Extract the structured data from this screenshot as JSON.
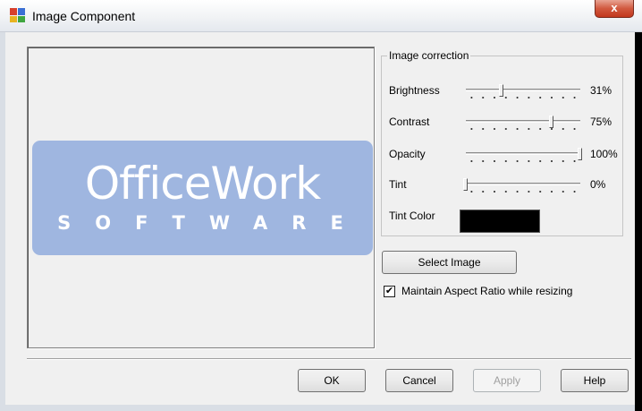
{
  "window": {
    "title": "Image Component",
    "close_glyph": "x"
  },
  "preview": {
    "logo_main": "OfficeWork",
    "logo_sub": "SOFTWARE",
    "logo_color": "#9fb6e0"
  },
  "image_correction": {
    "legend": "Image correction",
    "sliders": [
      {
        "label": "Brightness",
        "value_text": "31%",
        "value": 0.31
      },
      {
        "label": "Contrast",
        "value_text": "75%",
        "value": 0.75
      },
      {
        "label": "Opacity",
        "value_text": "100%",
        "value": 1.0
      },
      {
        "label": "Tint",
        "value_text": "0%",
        "value": 0.0
      }
    ],
    "tint_color_label": "Tint Color",
    "tint_color": "#000000"
  },
  "select_image_label": "Select Image",
  "maintain_aspect": {
    "label": "Maintain Aspect Ratio while resizing",
    "checked": true
  },
  "buttons": {
    "ok": "OK",
    "cancel": "Cancel",
    "apply": "Apply",
    "help": "Help"
  },
  "icons": {
    "app": "image-component-icon",
    "close": "close-icon"
  }
}
